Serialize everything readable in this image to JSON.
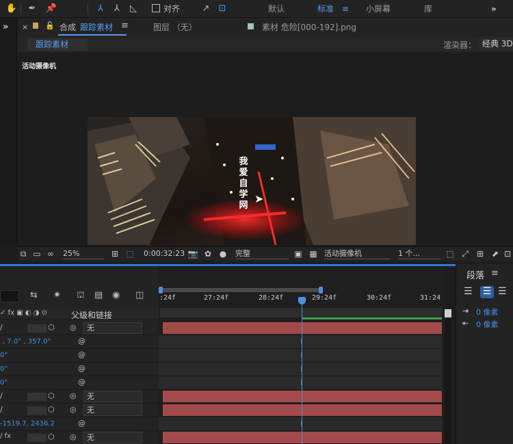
{
  "workspaces": {
    "default": "默认",
    "standard": "标准",
    "small_screen": "小屏幕",
    "library": "库"
  },
  "toolbar": {
    "snap_label": "对齐"
  },
  "panel_tabs": {
    "comp": {
      "prefix": "合成",
      "name": "跟踪素材"
    },
    "layer": {
      "label": "图层 （无）"
    },
    "footage": {
      "label": "素材 危险[000-192].png"
    }
  },
  "comp_view": {
    "subtab": "跟踪素材",
    "camera_label": "活动摄像机",
    "renderer_label": "渲染器：",
    "renderer_value": "经典 3D",
    "overlay_text": [
      "我",
      "爱",
      "自",
      "学",
      "网"
    ]
  },
  "viewer_bar": {
    "zoom": "25%",
    "timecode": "0:00:32:23",
    "resolution": "完整",
    "camera": "活动摄像机",
    "views": "1 个..."
  },
  "timeline": {
    "ruler_labels": [
      ":24f",
      "27:24f",
      "28:24f",
      "29:24f",
      "30:24f",
      "31:24"
    ],
    "column_header": "父级和链接",
    "rows": [
      {
        "value": "",
        "parent": "无"
      },
      {
        "value": ", 7.0° , 357.0°",
        "parent": ""
      },
      {
        "value": "0°",
        "parent": ""
      },
      {
        "value": "0°",
        "parent": ""
      },
      {
        "value": "0°",
        "parent": ""
      },
      {
        "value": "",
        "parent": "无"
      },
      {
        "value": "",
        "parent": "无"
      },
      {
        "value": "-1519.7, 2436.2",
        "parent": ""
      },
      {
        "value": "",
        "parent": "无"
      }
    ]
  },
  "paragraph_panel": {
    "title": "段落",
    "indent1": "0 像素",
    "indent2": "0 像素"
  },
  "colors": {
    "accent": "#5b9cf0",
    "layer_bar": "#a34a4a",
    "playhead": "#4a90e2"
  }
}
